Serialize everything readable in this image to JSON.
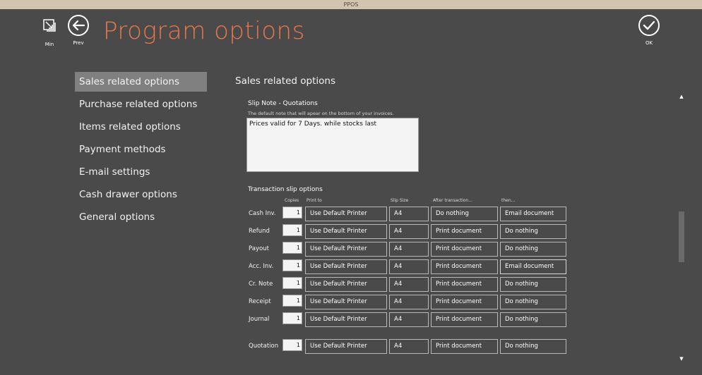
{
  "window": {
    "title": "PPOS"
  },
  "toolbar": {
    "min_label": "Min",
    "prev_label": "Prev",
    "ok_label": "OK"
  },
  "page": {
    "title": "Program options"
  },
  "nav": {
    "items": [
      {
        "label": "Sales related options",
        "active": true
      },
      {
        "label": "Purchase related options"
      },
      {
        "label": "Items related options"
      },
      {
        "label": "Payment methods"
      },
      {
        "label": "E-mail settings"
      },
      {
        "label": "Cash drawer options"
      },
      {
        "label": "General options"
      }
    ]
  },
  "content": {
    "section_title": "Sales related options",
    "slip_note": {
      "title": "Slip Note - Quotations",
      "hint": "The default note that will apear on the bottom of your invoices.",
      "value": "Prices valid for 7 Days. while stocks last"
    },
    "transaction": {
      "title": "Transaction slip options",
      "headers": {
        "copies": "Copies",
        "print_to": "Print to",
        "slip_size": "Slip Size",
        "after": "After transaction...",
        "then": "then..."
      },
      "rows": [
        {
          "label": "Cash Inv.",
          "copies": "1",
          "print_to": "Use Default Printer",
          "slip_size": "A4",
          "after": "Do nothing",
          "then": "Email document"
        },
        {
          "label": "Refund",
          "copies": "1",
          "print_to": "Use Default Printer",
          "slip_size": "A4",
          "after": "Print document",
          "then": "Do nothing"
        },
        {
          "label": "Payout",
          "copies": "1",
          "print_to": "Use Default Printer",
          "slip_size": "A4",
          "after": "Print document",
          "then": "Do nothing"
        },
        {
          "label": "Acc. Inv.",
          "copies": "1",
          "print_to": "Use Default Printer",
          "slip_size": "A4",
          "after": "Print document",
          "then": "Email document"
        },
        {
          "label": "Cr. Note",
          "copies": "1",
          "print_to": "Use Default Printer",
          "slip_size": "A4",
          "after": "Print document",
          "then": "Do nothing"
        },
        {
          "label": "Receipt",
          "copies": "1",
          "print_to": "Use Default Printer",
          "slip_size": "A4",
          "after": "Print document",
          "then": "Do nothing"
        },
        {
          "label": "Journal",
          "copies": "1",
          "print_to": "Use Default Printer",
          "slip_size": "A4",
          "after": "Print document",
          "then": "Do nothing"
        },
        {
          "label": "Quotation",
          "copies": "1",
          "print_to": "Use Default Printer",
          "slip_size": "A4",
          "after": "Print document",
          "then": "Do nothing"
        }
      ]
    }
  },
  "icons": {
    "min": "minimize-icon",
    "prev": "back-arrow-icon",
    "ok": "checkmark-icon"
  },
  "colors": {
    "background": "#4a4a4a",
    "accent": "#e8774a",
    "titlebar": "#d3c4b0",
    "nav_active": "#808080"
  }
}
